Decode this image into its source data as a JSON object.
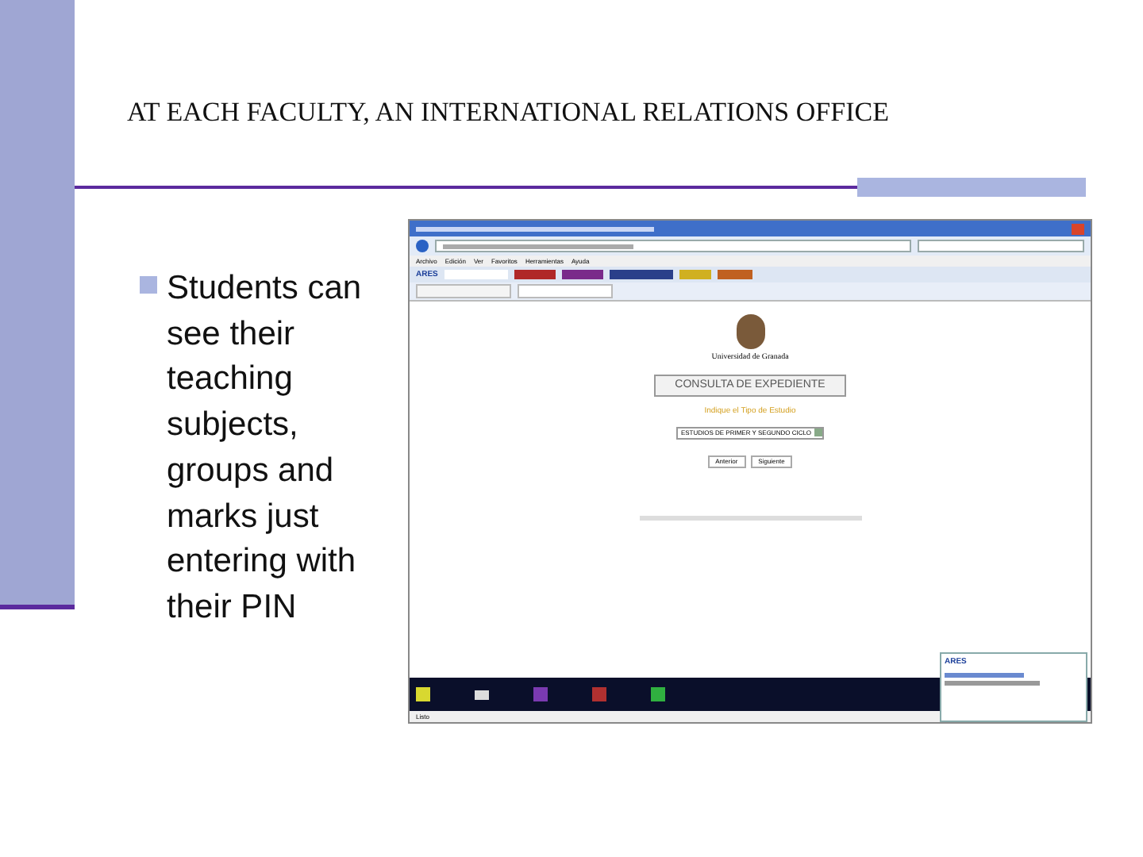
{
  "title": "AT EACH FACULTY, AN INTERNATIONAL RELATIONS OFFICE",
  "bullets": [
    "Students can see their teaching subjects, groups and marks just entering with their PIN"
  ],
  "screenshot": {
    "menu": [
      "Archivo",
      "Edición",
      "Ver",
      "Favoritos",
      "Herramientas",
      "Ayuda"
    ],
    "toolbar_label": "ARES",
    "university": "Universidad de Granada",
    "heading": "CONSULTA DE EXPEDIENTE",
    "prompt": "Indique el Tipo de Estudio",
    "select_value": "ESTUDIOS DE PRIMER Y SEGUNDO CICLO",
    "buttons": [
      "Anterior",
      "Siguiente"
    ],
    "popup_title": "ARES",
    "status": "Listo"
  }
}
